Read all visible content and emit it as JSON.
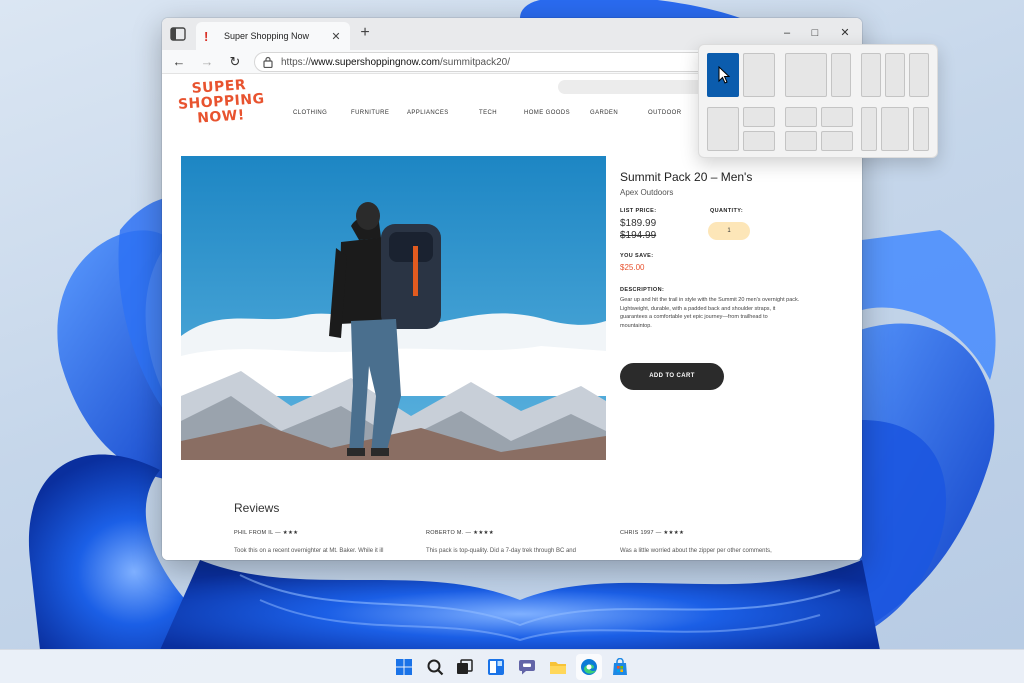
{
  "browser": {
    "tab_title": "Super Shopping Now",
    "tab_favicon": "!",
    "new_tab": "+",
    "url_prefix": "https://",
    "url_domain": "www.supershoppingnow.com",
    "url_path": "/summitpack20/",
    "window_controls": {
      "minimize": "–",
      "maximize": "□",
      "close": "✕"
    }
  },
  "site": {
    "logo_lines": [
      "SUPER",
      "SHOPPING",
      "NOW!"
    ],
    "nav": [
      "CLOTHING",
      "FURNITURE",
      "APPLIANCES",
      "TECH",
      "HOME GOODS",
      "GARDEN",
      "OUTDOOR"
    ]
  },
  "product": {
    "title": "Summit Pack 20 – Men's",
    "brand": "Apex Outdoors",
    "list_price_label": "LIST PRICE:",
    "price": "$189.99",
    "old_price": "$194.99",
    "quantity_label": "QUANTITY:",
    "quantity": "1",
    "you_save_label": "YOU SAVE:",
    "you_save": "$25.00",
    "description_label": "DESCRIPTION:",
    "description": "Gear up and hit the trail in style with the Summit 20 men's overnight pack. Lightweight, durable, with a padded back and shoulder straps, it guarantees a comfortable yet epic journey—from trailhead to mountaintop.",
    "add_to_cart": "ADD TO CART"
  },
  "reviews": {
    "heading": "Reviews",
    "items": [
      {
        "name": "PHIL FROM IL — ★★★",
        "text": "Took this on a recent overnighter at Mt. Baker. While it ill"
      },
      {
        "name": "ROBERTO M. — ★★★★",
        "text": "This pack is top-quality. Did a 7-day trek through BC and"
      },
      {
        "name": "CHRIS 1997 — ★★★★",
        "text": "Was a little worried about the zipper per other comments,"
      }
    ]
  },
  "snap_layouts": {
    "active_zone": "left-half-of-two-column-layout"
  },
  "taskbar": {
    "icons": [
      "start-icon",
      "search-icon",
      "task-view-icon",
      "widgets-icon",
      "teams-chat-icon",
      "file-explorer-icon",
      "edge-icon",
      "store-icon"
    ],
    "active": "edge-icon"
  },
  "colors": {
    "accent": "#0b5cad",
    "brand": "#e8532f",
    "sale": "#e8532f",
    "qty_bg": "#fde6b8",
    "cart_bg": "#2b2b2b"
  }
}
